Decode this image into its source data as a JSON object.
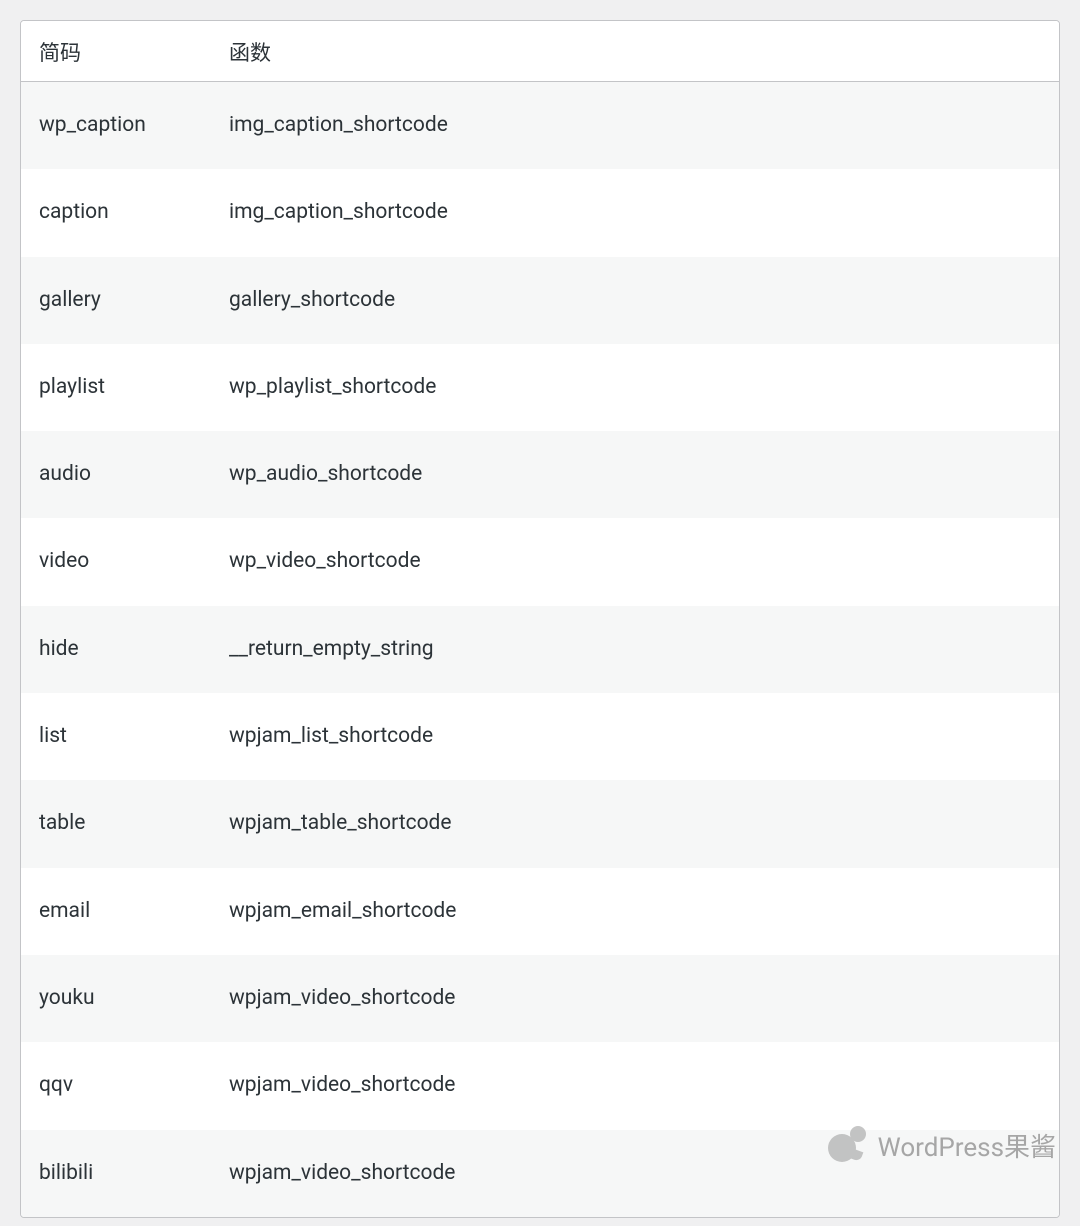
{
  "table": {
    "headers": {
      "shortcode": "简码",
      "function": "函数"
    },
    "rows": [
      {
        "shortcode": "wp_caption",
        "function": "img_caption_shortcode"
      },
      {
        "shortcode": "caption",
        "function": "img_caption_shortcode"
      },
      {
        "shortcode": "gallery",
        "function": "gallery_shortcode"
      },
      {
        "shortcode": "playlist",
        "function": "wp_playlist_shortcode"
      },
      {
        "shortcode": "audio",
        "function": "wp_audio_shortcode"
      },
      {
        "shortcode": "video",
        "function": "wp_video_shortcode"
      },
      {
        "shortcode": "hide",
        "function": "__return_empty_string"
      },
      {
        "shortcode": "list",
        "function": "wpjam_list_shortcode"
      },
      {
        "shortcode": "table",
        "function": "wpjam_table_shortcode"
      },
      {
        "shortcode": "email",
        "function": "wpjam_email_shortcode"
      },
      {
        "shortcode": "youku",
        "function": "wpjam_video_shortcode"
      },
      {
        "shortcode": "qqv",
        "function": "wpjam_video_shortcode"
      },
      {
        "shortcode": "bilibili",
        "function": "wpjam_video_shortcode"
      }
    ]
  },
  "watermark": {
    "text": "WordPress果酱"
  }
}
